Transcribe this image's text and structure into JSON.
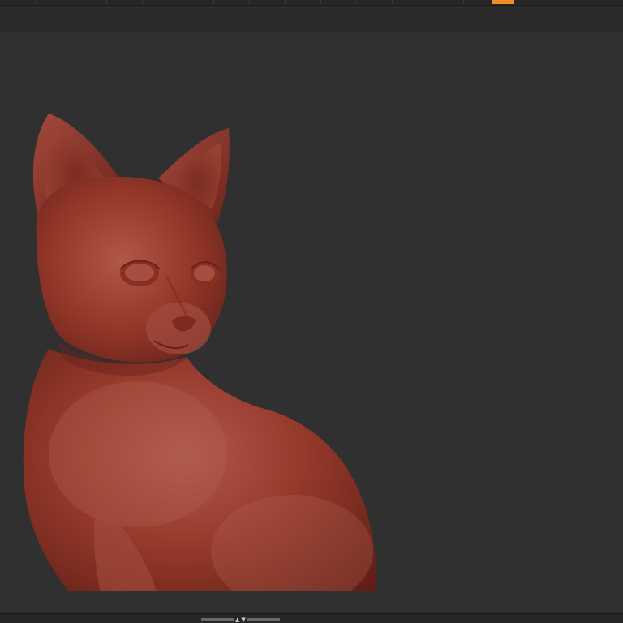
{
  "app": {
    "accent_color": "#f28c28",
    "background_color": "#303030",
    "model_color": "#8e3426"
  },
  "top_strip": {
    "segments": 14,
    "active_index": 1
  },
  "viewport": {
    "model": {
      "subject": "cat-sculpt"
    }
  },
  "bottom_bar": {
    "handle_up_glyph": "▲",
    "handle_down_glyph": "▼"
  }
}
